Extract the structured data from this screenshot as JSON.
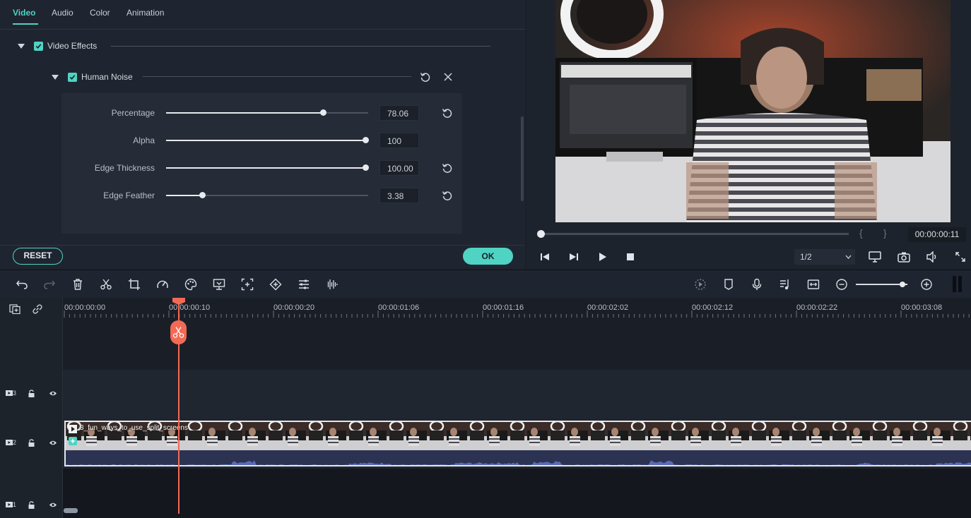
{
  "tabs": [
    "Video",
    "Audio",
    "Color",
    "Animation"
  ],
  "effects": {
    "section_label": "Video Effects",
    "effect_name": "Human Noise",
    "params": [
      {
        "label": "Percentage",
        "value": "78.06",
        "level": 0.775,
        "has_reset": true
      },
      {
        "label": "Alpha",
        "value": "100",
        "level": 1.0,
        "has_reset": false
      },
      {
        "label": "Edge Thickness",
        "value": "100.00",
        "level": 1.0,
        "has_reset": true
      },
      {
        "label": "Edge Feather",
        "value": "3.38",
        "level": 0.18,
        "has_reset": true
      }
    ],
    "reset_label": "RESET",
    "ok_label": "OK"
  },
  "preview": {
    "progress": 0.0,
    "timecode": "00:00:00:11",
    "quality": "1/2",
    "brace_in": "{",
    "brace_out": "}"
  },
  "toolbar": {
    "left_icons": [
      "undo-icon",
      "redo-icon",
      "delete-icon",
      "cut-icon",
      "crop-icon",
      "speed-icon",
      "color-icon",
      "greenscreen-icon",
      "freeze-icon",
      "keyframe-icon",
      "adjust-icon",
      "audio-wave-icon"
    ],
    "right_icons": [
      "render-icon",
      "marker-icon",
      "voiceover-icon",
      "audio-mix-icon",
      "fit-icon",
      "zoom-out-icon",
      "zoom-in-icon"
    ],
    "zoom_level": 0.9
  },
  "timeline": {
    "ruler_labels": [
      "00:00:00:00",
      "00:00:00:10",
      "00:00:00:20",
      "00:00:01:06",
      "00:00:01:16",
      "00:00:02:02",
      "00:00:02:12",
      "00:00:02:22",
      "00:00:03:08"
    ],
    "tracks": [
      {
        "number": "3"
      },
      {
        "number": "2"
      },
      {
        "number": "1"
      }
    ],
    "clip_name": "3_fun_ways_to_use_split_screens"
  },
  "colors": {
    "accent": "#4fd3c3",
    "playhead": "#f26a55",
    "background": "#1b2028"
  }
}
